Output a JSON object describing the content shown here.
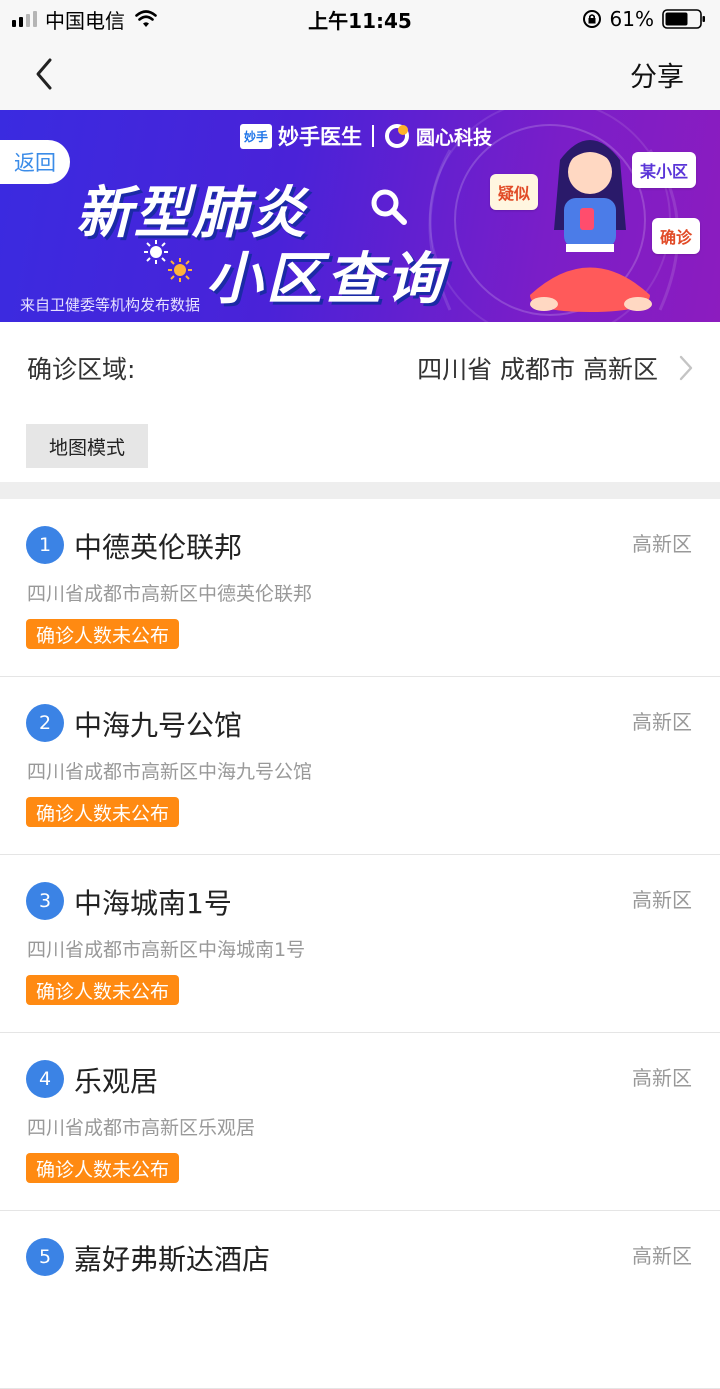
{
  "status_bar": {
    "carrier": "中国电信",
    "time": "上午11:45",
    "battery": "61%"
  },
  "nav": {
    "share_label": "分享"
  },
  "banner": {
    "return_label": "返回",
    "brand_logo_text": "妙手",
    "brand1": "妙手医生",
    "brand2": "圆心科技",
    "title_line1": "新型肺炎",
    "title_line2": "小区查询",
    "source_note": "来自卫健委等机构发布数据",
    "tag_suspected": "疑似",
    "tag_community": "某小区",
    "tag_confirmed": "确诊"
  },
  "region": {
    "label": "确诊区域:",
    "value": "四川省 成都市 高新区"
  },
  "map_mode_label": "地图模式",
  "colors": {
    "accent_blue": "#3b83e5",
    "badge_orange": "#ff8a12"
  },
  "communities": [
    {
      "index": "1",
      "name": "中德英伦联邦",
      "district": "高新区",
      "address": "四川省成都市高新区中德英伦联邦",
      "status": "确诊人数未公布"
    },
    {
      "index": "2",
      "name": "中海九号公馆",
      "district": "高新区",
      "address": "四川省成都市高新区中海九号公馆",
      "status": "确诊人数未公布"
    },
    {
      "index": "3",
      "name": "中海城南1号",
      "district": "高新区",
      "address": "四川省成都市高新区中海城南1号",
      "status": "确诊人数未公布"
    },
    {
      "index": "4",
      "name": "乐观居",
      "district": "高新区",
      "address": "四川省成都市高新区乐观居",
      "status": "确诊人数未公布"
    },
    {
      "index": "5",
      "name": "嘉好弗斯达酒店",
      "district": "高新区",
      "address": "",
      "status": ""
    }
  ]
}
